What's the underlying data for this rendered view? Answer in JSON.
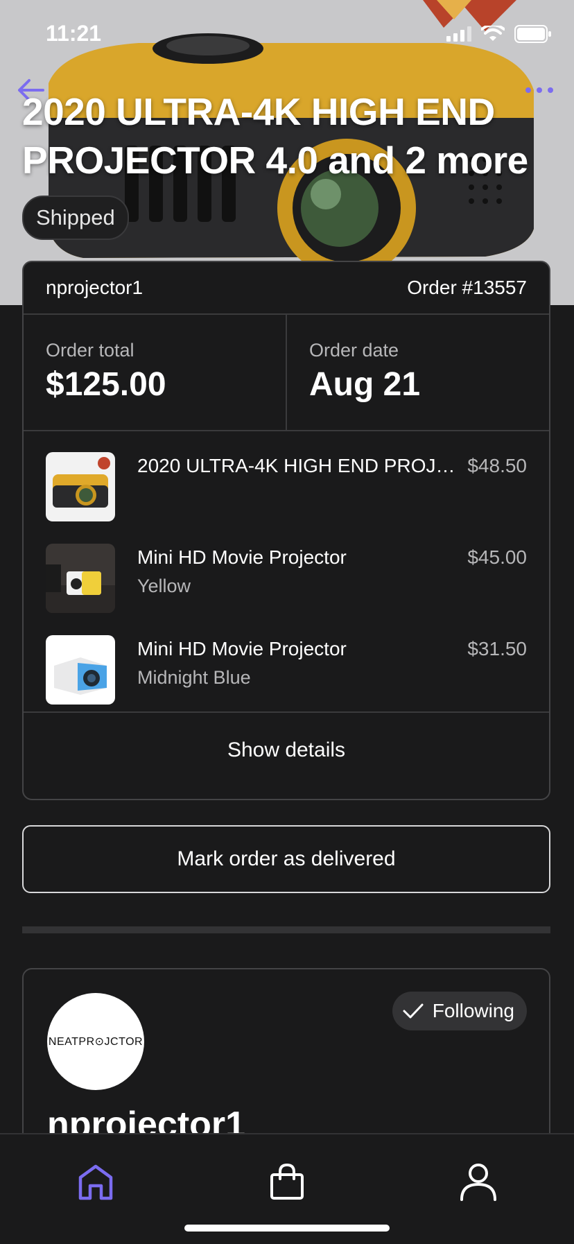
{
  "status_bar": {
    "time": "11:21"
  },
  "header": {
    "title": "2020 ULTRA-4K HIGH END PROJECTOR 4.0 and 2 more",
    "status_chip": "Shipped"
  },
  "order": {
    "seller": "nprojector1",
    "order_number": "Order #13557",
    "total_label": "Order total",
    "total_value": "$125.00",
    "date_label": "Order date",
    "date_value": "Aug 21",
    "items": [
      {
        "name": "2020 ULTRA-4K HIGH END PROJECTOR 4.0",
        "variant": "",
        "price": "$48.50"
      },
      {
        "name": "Mini HD Movie Projector",
        "variant": "Yellow",
        "price": "$45.00"
      },
      {
        "name": "Mini HD Movie Projector",
        "variant": "Midnight Blue",
        "price": "$31.50"
      }
    ],
    "show_details": "Show details",
    "mark_delivered": "Mark order as delivered"
  },
  "seller_card": {
    "avatar_text": "NEATPR⊙JCTOR",
    "follow_label": "Following",
    "name": "nprojector1"
  },
  "tabbar": {
    "tabs": [
      {
        "icon": "home-icon",
        "active": true
      },
      {
        "icon": "bag-icon",
        "active": false
      },
      {
        "icon": "profile-icon",
        "active": false
      }
    ],
    "accent": "#7b6cf0"
  }
}
